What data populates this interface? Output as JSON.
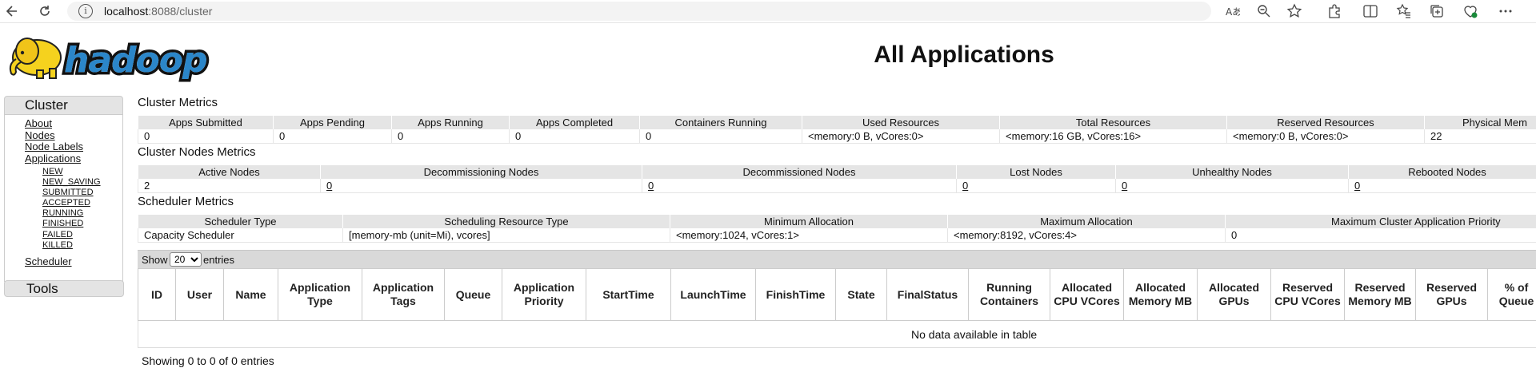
{
  "browser": {
    "url_host": "localhost",
    "url_path": ":8088/cluster",
    "icons": [
      "back-icon",
      "reload-icon",
      "info-icon",
      "read-aloud-icon",
      "zoom-icon",
      "favorite-star-icon",
      "extensions-icon",
      "split-screen-icon",
      "favorites-icon",
      "collections-icon",
      "browser-essentials-icon",
      "more-icon"
    ]
  },
  "header": {
    "title": "All Applications",
    "logo_text": "hadoop"
  },
  "nav": {
    "cluster_label": "Cluster",
    "items": [
      "About",
      "Nodes",
      "Node Labels",
      "Applications"
    ],
    "app_states": [
      "NEW",
      "NEW_SAVING",
      "SUBMITTED",
      "ACCEPTED",
      "RUNNING",
      "FINISHED",
      "FAILED",
      "KILLED"
    ],
    "scheduler_label": "Scheduler",
    "tools_label": "Tools"
  },
  "cluster_metrics": {
    "title": "Cluster Metrics",
    "headers": [
      "Apps Submitted",
      "Apps Pending",
      "Apps Running",
      "Apps Completed",
      "Containers Running",
      "Used Resources",
      "Total Resources",
      "Reserved Resources",
      "Physical Mem"
    ],
    "values": [
      "0",
      "0",
      "0",
      "0",
      "0",
      "<memory:0 B, vCores:0>",
      "<memory:16 GB, vCores:16>",
      "<memory:0 B, vCores:0>",
      "22"
    ]
  },
  "node_metrics": {
    "title": "Cluster Nodes Metrics",
    "headers": [
      "Active Nodes",
      "Decommissioning Nodes",
      "Decommissioned Nodes",
      "Lost Nodes",
      "Unhealthy Nodes",
      "Rebooted Nodes"
    ],
    "values": [
      "2",
      "0",
      "0",
      "0",
      "0",
      "0"
    ]
  },
  "scheduler_metrics": {
    "title": "Scheduler Metrics",
    "headers": [
      "Scheduler Type",
      "Scheduling Resource Type",
      "Minimum Allocation",
      "Maximum Allocation",
      "Maximum Cluster Application Priority"
    ],
    "values": [
      "Capacity Scheduler",
      "[memory-mb (unit=Mi), vcores]",
      "<memory:1024, vCores:1>",
      "<memory:8192, vCores:4>",
      "0"
    ]
  },
  "apps": {
    "show_label": "Show",
    "page_size": "20",
    "entries_label": "entries",
    "columns": [
      "ID",
      "User",
      "Name",
      "Application Type",
      "Application Tags",
      "Queue",
      "Application Priority",
      "StartTime",
      "LaunchTime",
      "FinishTime",
      "State",
      "FinalStatus",
      "Running Containers",
      "Allocated CPU VCores",
      "Allocated Memory MB",
      "Allocated GPUs",
      "Reserved CPU VCores",
      "Reserved Memory MB",
      "Reserved GPUs",
      "% of Queue"
    ],
    "empty_message": "No data available in table",
    "info": "Showing 0 to 0 of 0 entries"
  }
}
